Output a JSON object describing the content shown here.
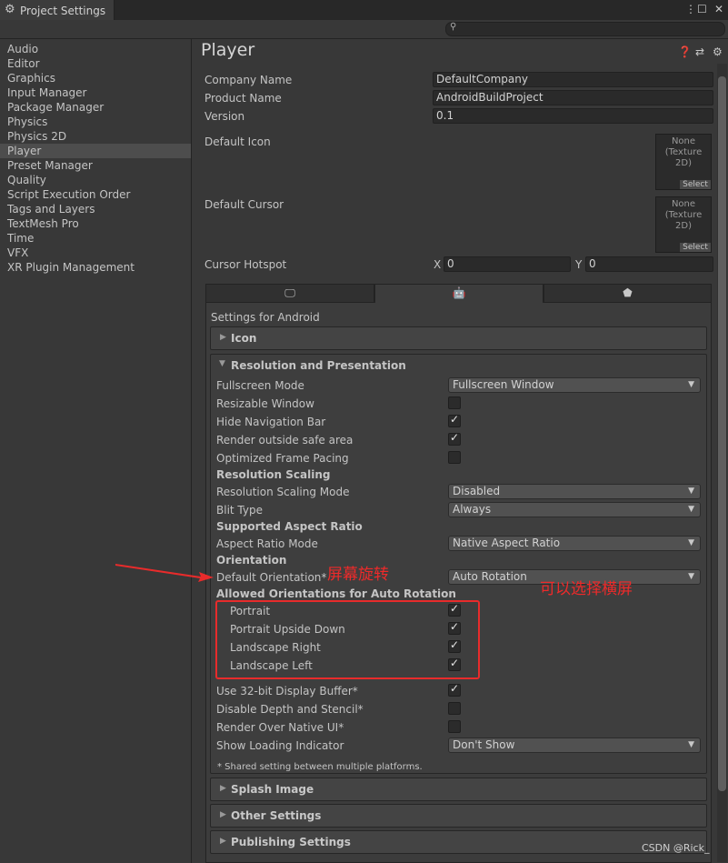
{
  "window": {
    "tab_title": "Project Settings",
    "search_placeholder": ""
  },
  "sidebar": {
    "items": [
      {
        "label": "Audio"
      },
      {
        "label": "Editor"
      },
      {
        "label": "Graphics"
      },
      {
        "label": "Input Manager"
      },
      {
        "label": "Package Manager"
      },
      {
        "label": "Physics"
      },
      {
        "label": "Physics 2D"
      },
      {
        "label": "Player",
        "selected": true
      },
      {
        "label": "Preset Manager"
      },
      {
        "label": "Quality"
      },
      {
        "label": "Script Execution Order"
      },
      {
        "label": "Tags and Layers"
      },
      {
        "label": "TextMesh Pro"
      },
      {
        "label": "Time"
      },
      {
        "label": "VFX"
      },
      {
        "label": "XR Plugin Management"
      }
    ]
  },
  "player": {
    "title": "Player",
    "company_label": "Company Name",
    "company_value": "DefaultCompany",
    "product_label": "Product Name",
    "product_value": "AndroidBuildProject",
    "version_label": "Version",
    "version_value": "0.1",
    "default_icon_label": "Default Icon",
    "default_cursor_label": "Default Cursor",
    "texture_none": "None",
    "texture_type": "(Texture 2D)",
    "select_label": "Select",
    "hotspot_label": "Cursor Hotspot",
    "hotspot_x_label": "X",
    "hotspot_x_value": "0",
    "hotspot_y_label": "Y",
    "hotspot_y_value": "0"
  },
  "platform_tabs": [
    {
      "icon": "monitor-icon"
    },
    {
      "icon": "android-icon",
      "active": true
    },
    {
      "icon": "html5-icon"
    }
  ],
  "android": {
    "settings_for": "Settings for Android",
    "icon_section": "Icon",
    "resolution_section": "Resolution and Presentation",
    "fullscreen_mode_label": "Fullscreen Mode",
    "fullscreen_mode_value": "Fullscreen Window",
    "resizable_window_label": "Resizable Window",
    "hide_nav_label": "Hide Navigation Bar",
    "render_outside_label": "Render outside safe area",
    "optimized_pacing_label": "Optimized Frame Pacing",
    "resolution_scaling_header": "Resolution Scaling",
    "resolution_scaling_mode_label": "Resolution Scaling Mode",
    "resolution_scaling_mode_value": "Disabled",
    "blit_type_label": "Blit Type",
    "blit_type_value": "Always",
    "supported_aspect_header": "Supported Aspect Ratio",
    "aspect_mode_label": "Aspect Ratio Mode",
    "aspect_mode_value": "Native Aspect Ratio",
    "orientation_header": "Orientation",
    "default_orientation_label": "Default Orientation*",
    "default_orientation_value": "Auto Rotation",
    "allowed_orientations_header": "Allowed Orientations for Auto Rotation",
    "portrait_label": "Portrait",
    "portrait_upside_label": "Portrait Upside Down",
    "landscape_right_label": "Landscape Right",
    "landscape_left_label": "Landscape Left",
    "use32_label": "Use 32-bit Display Buffer*",
    "disable_depth_label": "Disable Depth and Stencil*",
    "render_over_native_label": "Render Over Native UI*",
    "show_loading_label": "Show Loading Indicator",
    "show_loading_value": "Don't Show",
    "shared_note": "* Shared setting between multiple platforms.",
    "splash_section": "Splash Image",
    "other_section": "Other Settings",
    "publishing_section": "Publishing Settings",
    "checks": {
      "resizable_window": false,
      "hide_nav": true,
      "render_outside": true,
      "optimized_pacing": false,
      "portrait": true,
      "portrait_upside": true,
      "landscape_right": true,
      "landscape_left": true,
      "use32": true,
      "disable_depth": false,
      "render_over_native": false
    }
  },
  "annotations": {
    "rotate_label": "屏幕旋转",
    "landscape_label": "可以选择横屏",
    "highlight_color": "#e82b2b"
  },
  "watermark": "CSDN @Rick_"
}
